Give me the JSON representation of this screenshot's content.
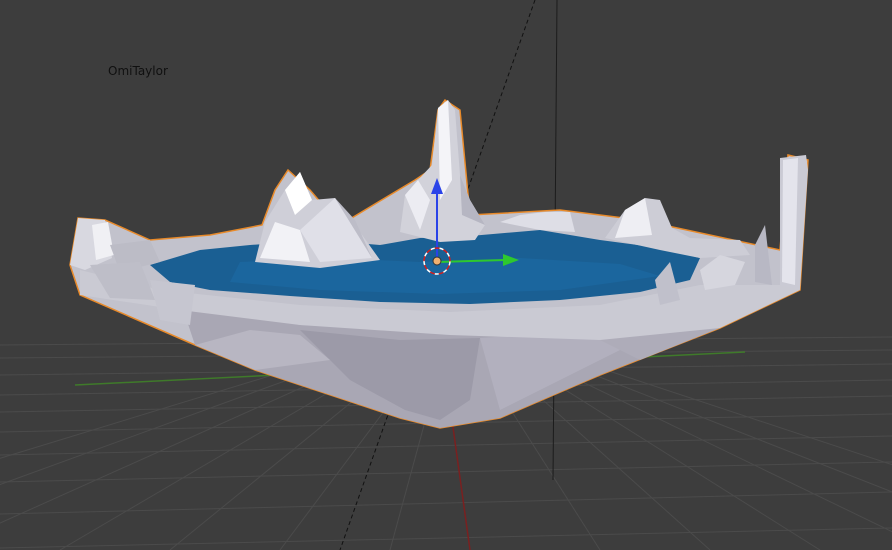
{
  "viewport": {
    "overlay_label": "OmiTaylor",
    "background_color": "#3d3d3d",
    "grid_color": "#4a4a4a",
    "x_axis_color": "#7a2020",
    "y_axis_color": "#3f7a2a",
    "gizmo": {
      "x_axis_color": "#2ec82e",
      "z_axis_color": "#2a43e8",
      "icons": [
        "move-gizmo-icon",
        "3d-cursor-icon"
      ]
    },
    "object": {
      "name_visible": false,
      "rock_color": "#b9b9c4",
      "water_color": "#1a5f93",
      "selection_outline_color": "#e88a2a"
    }
  }
}
